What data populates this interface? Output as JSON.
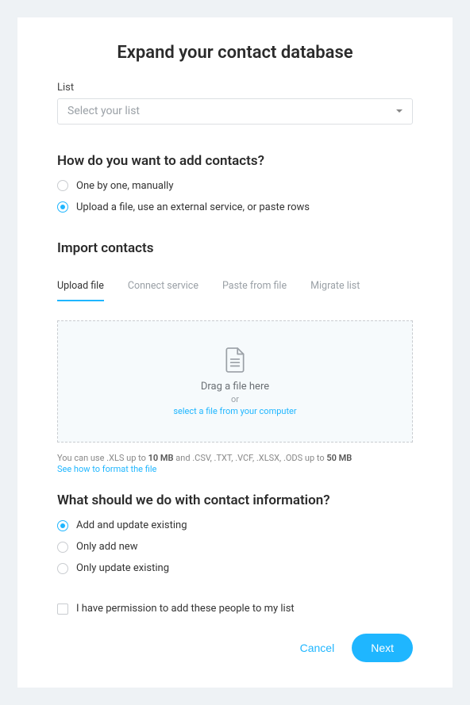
{
  "title": "Expand your contact database",
  "list": {
    "label": "List",
    "placeholder": "Select your list"
  },
  "add_method": {
    "heading": "How do you want to add contacts?",
    "options": [
      {
        "label": "One by one, manually",
        "selected": false
      },
      {
        "label": "Upload a file, use an external service, or paste rows",
        "selected": true
      }
    ]
  },
  "import": {
    "heading": "Import contacts",
    "tabs": [
      {
        "label": "Upload file",
        "active": true
      },
      {
        "label": "Connect service",
        "active": false
      },
      {
        "label": "Paste from file",
        "active": false
      },
      {
        "label": "Migrate list",
        "active": false
      }
    ],
    "dropzone": {
      "drag_text": "Drag a file here",
      "or": "or",
      "select_link": "select a file from your computer"
    },
    "hint_pre": "You can use .XLS up to ",
    "hint_limit1": "10 MB",
    "hint_mid": " and .CSV, .TXT, .VCF, .XLSX, .ODS up to ",
    "hint_limit2": "50 MB",
    "hint_link": "See how to format the file"
  },
  "info_handling": {
    "heading": "What should we do with contact information?",
    "options": [
      {
        "label": "Add and update existing",
        "selected": true
      },
      {
        "label": "Only add new",
        "selected": false
      },
      {
        "label": "Only update existing",
        "selected": false
      }
    ]
  },
  "permission": {
    "label": "I have permission to add these people to my list",
    "checked": false
  },
  "actions": {
    "cancel": "Cancel",
    "next": "Next"
  }
}
